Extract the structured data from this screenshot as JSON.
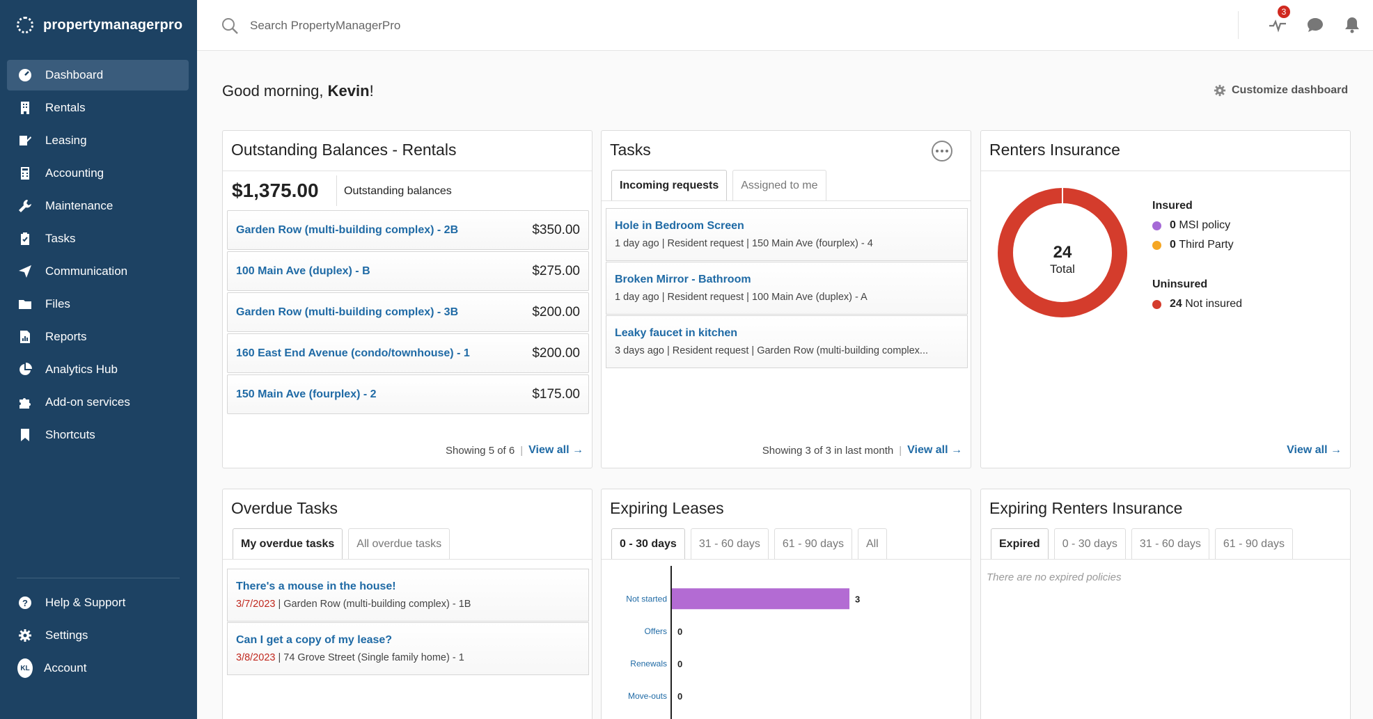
{
  "app": {
    "name": "propertymanagerpro"
  },
  "sidebar": {
    "items": [
      {
        "label": "Dashboard",
        "icon": "dashboard-icon",
        "active": true
      },
      {
        "label": "Rentals",
        "icon": "building-icon"
      },
      {
        "label": "Leasing",
        "icon": "leasing-icon"
      },
      {
        "label": "Accounting",
        "icon": "calculator-icon"
      },
      {
        "label": "Maintenance",
        "icon": "wrench-icon"
      },
      {
        "label": "Tasks",
        "icon": "clipboard-icon"
      },
      {
        "label": "Communication",
        "icon": "paper-plane-icon"
      },
      {
        "label": "Files",
        "icon": "folder-icon"
      },
      {
        "label": "Reports",
        "icon": "report-icon"
      },
      {
        "label": "Analytics Hub",
        "icon": "pie-chart-icon"
      },
      {
        "label": "Add-on services",
        "icon": "puzzle-icon"
      },
      {
        "label": "Shortcuts",
        "icon": "bookmark-icon"
      }
    ],
    "bottom": [
      {
        "label": "Help & Support",
        "icon": "help-icon"
      },
      {
        "label": "Settings",
        "icon": "gear-icon"
      },
      {
        "label": "Account",
        "icon": "avatar",
        "initials": "KL"
      }
    ]
  },
  "topbar": {
    "search_placeholder": "Search PropertyManagerPro",
    "activity_badge": "3"
  },
  "greeting": {
    "prefix": "Good morning, ",
    "name": "Kevin",
    "suffix": "!"
  },
  "customize_label": "Customize dashboard",
  "balances": {
    "title": "Outstanding Balances - Rentals",
    "total": "$1,375.00",
    "total_label": "Outstanding balances",
    "rows": [
      {
        "name": "Garden Row (multi-building complex) - 2B",
        "amount": "$350.00"
      },
      {
        "name": "100 Main Ave (duplex) - B",
        "amount": "$275.00"
      },
      {
        "name": "Garden Row (multi-building complex) - 3B",
        "amount": "$200.00"
      },
      {
        "name": "160 East End Avenue (condo/townhouse) - 1",
        "amount": "$200.00"
      },
      {
        "name": "150 Main Ave (fourplex) - 2",
        "amount": "$175.00"
      }
    ],
    "showing": "Showing 5 of 6",
    "view_all": "View all"
  },
  "tasks": {
    "title": "Tasks",
    "tabs": [
      "Incoming requests",
      "Assigned to me"
    ],
    "rows": [
      {
        "title": "Hole in Bedroom Screen",
        "meta": "1 day ago | Resident request | 150 Main Ave (fourplex) - 4"
      },
      {
        "title": "Broken Mirror - Bathroom",
        "meta": "1 day ago | Resident request | 100 Main Ave (duplex) - A"
      },
      {
        "title": "Leaky faucet in kitchen",
        "meta": "3 days ago | Resident request | Garden Row (multi-building complex..."
      }
    ],
    "showing": "Showing 3 of 3 in last month",
    "view_all": "View all"
  },
  "insurance": {
    "title": "Renters Insurance",
    "total": "24",
    "total_label": "Total",
    "insured_label": "Insured",
    "uninsured_label": "Uninsured",
    "msi": {
      "count": "0",
      "label": "MSI policy",
      "color": "#a569d6"
    },
    "third": {
      "count": "0",
      "label": "Third Party",
      "color": "#f5a623"
    },
    "not_insured": {
      "count": "24",
      "label": "Not insured",
      "color": "#d43c2c"
    },
    "view_all": "View all"
  },
  "overdue": {
    "title": "Overdue Tasks",
    "tabs": [
      "My overdue tasks",
      "All overdue tasks"
    ],
    "rows": [
      {
        "title": "There's a mouse in the house!",
        "date": "3/7/2023",
        "meta": " | Garden Row (multi-building complex) - 1B"
      },
      {
        "title": "Can I get a copy of my lease?",
        "date": "3/8/2023",
        "meta": " | 74 Grove Street (Single family home) - 1"
      }
    ]
  },
  "leases": {
    "title": "Expiring Leases",
    "tabs": [
      "0 - 30 days",
      "31 - 60 days",
      "61 - 90 days",
      "All"
    ]
  },
  "chart_data": {
    "type": "bar",
    "orientation": "horizontal",
    "categories": [
      "Not started",
      "Offers",
      "Renewals",
      "Move-outs"
    ],
    "values": [
      3,
      0,
      0,
      0
    ],
    "bar_color": "#b36bd3"
  },
  "expiring_insurance": {
    "title": "Expiring Renters Insurance",
    "tabs": [
      "Expired",
      "0 - 30 days",
      "31 - 60 days",
      "61 - 90 days"
    ],
    "empty": "There are no expired policies"
  }
}
